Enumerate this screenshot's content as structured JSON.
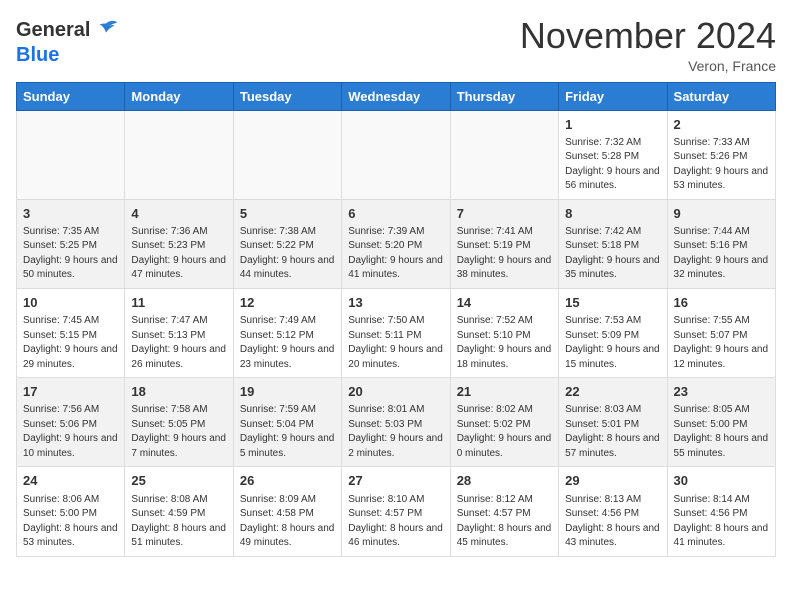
{
  "header": {
    "logo_general": "General",
    "logo_blue": "Blue",
    "month_title": "November 2024",
    "location": "Veron, France"
  },
  "days_of_week": [
    "Sunday",
    "Monday",
    "Tuesday",
    "Wednesday",
    "Thursday",
    "Friday",
    "Saturday"
  ],
  "weeks": [
    {
      "days": [
        {
          "num": "",
          "info": ""
        },
        {
          "num": "",
          "info": ""
        },
        {
          "num": "",
          "info": ""
        },
        {
          "num": "",
          "info": ""
        },
        {
          "num": "",
          "info": ""
        },
        {
          "num": "1",
          "info": "Sunrise: 7:32 AM\nSunset: 5:28 PM\nDaylight: 9 hours and 56 minutes."
        },
        {
          "num": "2",
          "info": "Sunrise: 7:33 AM\nSunset: 5:26 PM\nDaylight: 9 hours and 53 minutes."
        }
      ]
    },
    {
      "days": [
        {
          "num": "3",
          "info": "Sunrise: 7:35 AM\nSunset: 5:25 PM\nDaylight: 9 hours and 50 minutes."
        },
        {
          "num": "4",
          "info": "Sunrise: 7:36 AM\nSunset: 5:23 PM\nDaylight: 9 hours and 47 minutes."
        },
        {
          "num": "5",
          "info": "Sunrise: 7:38 AM\nSunset: 5:22 PM\nDaylight: 9 hours and 44 minutes."
        },
        {
          "num": "6",
          "info": "Sunrise: 7:39 AM\nSunset: 5:20 PM\nDaylight: 9 hours and 41 minutes."
        },
        {
          "num": "7",
          "info": "Sunrise: 7:41 AM\nSunset: 5:19 PM\nDaylight: 9 hours and 38 minutes."
        },
        {
          "num": "8",
          "info": "Sunrise: 7:42 AM\nSunset: 5:18 PM\nDaylight: 9 hours and 35 minutes."
        },
        {
          "num": "9",
          "info": "Sunrise: 7:44 AM\nSunset: 5:16 PM\nDaylight: 9 hours and 32 minutes."
        }
      ]
    },
    {
      "days": [
        {
          "num": "10",
          "info": "Sunrise: 7:45 AM\nSunset: 5:15 PM\nDaylight: 9 hours and 29 minutes."
        },
        {
          "num": "11",
          "info": "Sunrise: 7:47 AM\nSunset: 5:13 PM\nDaylight: 9 hours and 26 minutes."
        },
        {
          "num": "12",
          "info": "Sunrise: 7:49 AM\nSunset: 5:12 PM\nDaylight: 9 hours and 23 minutes."
        },
        {
          "num": "13",
          "info": "Sunrise: 7:50 AM\nSunset: 5:11 PM\nDaylight: 9 hours and 20 minutes."
        },
        {
          "num": "14",
          "info": "Sunrise: 7:52 AM\nSunset: 5:10 PM\nDaylight: 9 hours and 18 minutes."
        },
        {
          "num": "15",
          "info": "Sunrise: 7:53 AM\nSunset: 5:09 PM\nDaylight: 9 hours and 15 minutes."
        },
        {
          "num": "16",
          "info": "Sunrise: 7:55 AM\nSunset: 5:07 PM\nDaylight: 9 hours and 12 minutes."
        }
      ]
    },
    {
      "days": [
        {
          "num": "17",
          "info": "Sunrise: 7:56 AM\nSunset: 5:06 PM\nDaylight: 9 hours and 10 minutes."
        },
        {
          "num": "18",
          "info": "Sunrise: 7:58 AM\nSunset: 5:05 PM\nDaylight: 9 hours and 7 minutes."
        },
        {
          "num": "19",
          "info": "Sunrise: 7:59 AM\nSunset: 5:04 PM\nDaylight: 9 hours and 5 minutes."
        },
        {
          "num": "20",
          "info": "Sunrise: 8:01 AM\nSunset: 5:03 PM\nDaylight: 9 hours and 2 minutes."
        },
        {
          "num": "21",
          "info": "Sunrise: 8:02 AM\nSunset: 5:02 PM\nDaylight: 9 hours and 0 minutes."
        },
        {
          "num": "22",
          "info": "Sunrise: 8:03 AM\nSunset: 5:01 PM\nDaylight: 8 hours and 57 minutes."
        },
        {
          "num": "23",
          "info": "Sunrise: 8:05 AM\nSunset: 5:00 PM\nDaylight: 8 hours and 55 minutes."
        }
      ]
    },
    {
      "days": [
        {
          "num": "24",
          "info": "Sunrise: 8:06 AM\nSunset: 5:00 PM\nDaylight: 8 hours and 53 minutes."
        },
        {
          "num": "25",
          "info": "Sunrise: 8:08 AM\nSunset: 4:59 PM\nDaylight: 8 hours and 51 minutes."
        },
        {
          "num": "26",
          "info": "Sunrise: 8:09 AM\nSunset: 4:58 PM\nDaylight: 8 hours and 49 minutes."
        },
        {
          "num": "27",
          "info": "Sunrise: 8:10 AM\nSunset: 4:57 PM\nDaylight: 8 hours and 46 minutes."
        },
        {
          "num": "28",
          "info": "Sunrise: 8:12 AM\nSunset: 4:57 PM\nDaylight: 8 hours and 45 minutes."
        },
        {
          "num": "29",
          "info": "Sunrise: 8:13 AM\nSunset: 4:56 PM\nDaylight: 8 hours and 43 minutes."
        },
        {
          "num": "30",
          "info": "Sunrise: 8:14 AM\nSunset: 4:56 PM\nDaylight: 8 hours and 41 minutes."
        }
      ]
    }
  ]
}
